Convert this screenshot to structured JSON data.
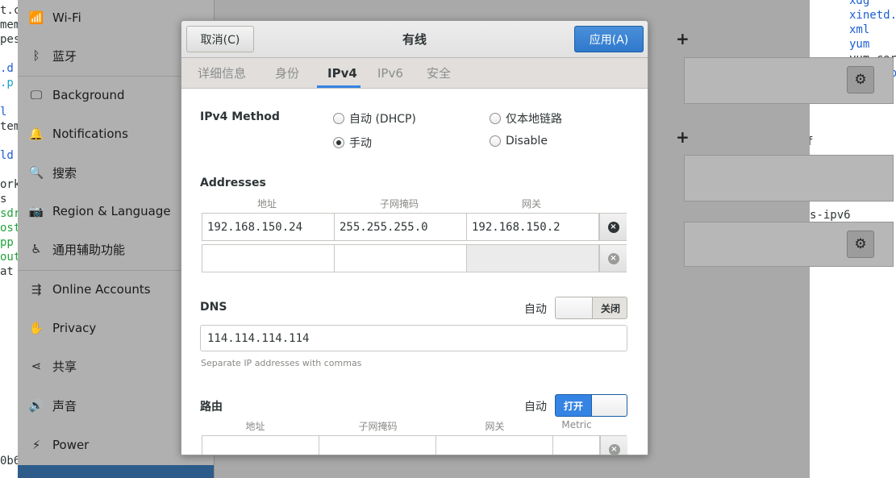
{
  "terminal": {
    "left_lines": [
      {
        "text": "t.c",
        "color": "dark"
      },
      {
        "text": "mem",
        "color": "dark"
      },
      {
        "text": "pes",
        "color": "dark"
      },
      {
        "text": "",
        "color": "dark"
      },
      {
        "text": ".d",
        "color": "blue"
      },
      {
        "text": ".p",
        "color": "cyan"
      },
      {
        "text": "",
        "color": "dark"
      },
      {
        "text": "l",
        "color": "blue"
      },
      {
        "text": "tem",
        "color": "dark"
      },
      {
        "text": "",
        "color": "dark"
      },
      {
        "text": "ld",
        "color": "blue"
      },
      {
        "text": "",
        "color": "dark"
      },
      {
        "text": "ork",
        "color": "dark"
      },
      {
        "text": "s",
        "color": "dark"
      },
      {
        "text": "sdr",
        "color": "green"
      },
      {
        "text": "ost",
        "color": "green"
      },
      {
        "text": "pp",
        "color": "green"
      },
      {
        "text": "out",
        "color": "green"
      },
      {
        "text": "at",
        "color": "dark"
      }
    ],
    "bottom_left": "0b6",
    "right_lines": [
      {
        "text": "xdg",
        "color": "blue"
      },
      {
        "text": "xinetd.",
        "color": "blue"
      },
      {
        "text": "xml",
        "color": "blue"
      },
      {
        "text": "yum",
        "color": "blue"
      },
      {
        "text": "yum.cor",
        "color": "dark"
      },
      {
        "text": "yum.rep",
        "color": "blue"
      }
    ],
    "mid_f": "f",
    "mid_ipv6": "s-ipv6"
  },
  "sidebar": {
    "items": [
      {
        "label": "Wi-Fi",
        "icon": "wifi-icon",
        "glyph": "📶"
      },
      {
        "label": "蓝牙",
        "icon": "bluetooth-icon",
        "glyph": "ᛒ"
      },
      {
        "label": "Background",
        "icon": "background-icon",
        "glyph": "🖵"
      },
      {
        "label": "Notifications",
        "icon": "bell-icon",
        "glyph": "🔔"
      },
      {
        "label": "搜索",
        "icon": "search-icon",
        "glyph": "🔍"
      },
      {
        "label": "Region & Language",
        "icon": "camera-icon",
        "glyph": "📷"
      },
      {
        "label": "通用辅助功能",
        "icon": "accessibility-icon",
        "glyph": "♿"
      },
      {
        "label": "Online Accounts",
        "icon": "online-accounts-icon",
        "glyph": "⇶"
      },
      {
        "label": "Privacy",
        "icon": "hand-icon",
        "glyph": "✋"
      },
      {
        "label": "共享",
        "icon": "share-icon",
        "glyph": "⋖"
      },
      {
        "label": "声音",
        "icon": "speaker-icon",
        "glyph": "🔊"
      },
      {
        "label": "Power",
        "icon": "power-icon",
        "glyph": "⚡"
      }
    ]
  },
  "settings_panel": {
    "plus": "+",
    "gear": "⚙"
  },
  "dialog": {
    "title": "有线",
    "cancel_label": "取消(C)",
    "apply_label": "应用(A)",
    "tabs": [
      "详细信息",
      "身份",
      "IPv4",
      "IPv6",
      "安全"
    ],
    "active_tab": "IPv4",
    "ipv4_method_label": "IPv4 Method",
    "methods": {
      "auto_dhcp": "自动 (DHCP)",
      "link_local": "仅本地链路",
      "manual": "手动",
      "disable": "Disable",
      "selected": "manual"
    },
    "addresses": {
      "label": "Addresses",
      "headers": {
        "address": "地址",
        "netmask": "子网掩码",
        "gateway": "网关"
      },
      "rows": [
        {
          "address": "192.168.150.24",
          "netmask": "255.255.255.0",
          "gateway": "192.168.150.2"
        },
        {
          "address": "",
          "netmask": "",
          "gateway": ""
        }
      ]
    },
    "dns": {
      "label": "DNS",
      "auto_label": "自动",
      "auto_state": "关闭",
      "value": "114.114.114.114",
      "hint": "Separate IP addresses with commas"
    },
    "routes": {
      "label": "路由",
      "auto_label": "自动",
      "auto_state": "打开",
      "headers": {
        "address": "地址",
        "netmask": "子网掩码",
        "gateway": "网关",
        "metric": "Metric"
      }
    },
    "delete_glyph": "×"
  },
  "colors": {
    "accent": "#3584e4",
    "apply_button": "#3a85d5"
  }
}
